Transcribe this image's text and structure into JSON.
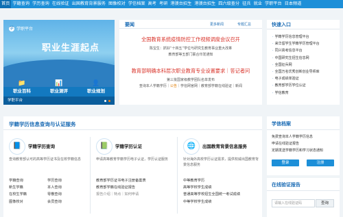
{
  "topnav": [
    "首页",
    "学籍查询",
    "学历查询",
    "在线验证",
    "出国教育背景服务",
    "图像校对",
    "学信档案",
    "高考",
    "考研",
    "港澳台招生",
    "港澳台招生",
    "四六级查分",
    "征兵",
    "就业",
    "学职平台",
    "日本频道"
  ],
  "promo": {
    "logo": "学职平台",
    "headline": "职业生涯起点",
    "icons": [
      {
        "glyph": "📁",
        "label": "职业百科"
      },
      {
        "glyph": "📊",
        "label": "职业测评"
      },
      {
        "glyph": "👤",
        "label": "职业规划"
      }
    ],
    "caption": "学职平台"
  },
  "news": {
    "title": "要闻",
    "more1": "更多新闻",
    "more2": "专题汇总",
    "h1": "全国教育系统疫情防控工作视频调度会议召开",
    "s1": "陈宝生：抓好“十四五”学位与研究生教育事业重大改革",
    "s2": "教育部等五部门联合印发通知",
    "h2": "教育部明确本科层次职业教育专业设置要求｜答记者问",
    "s3": "第三批国家级教学团队名单发布",
    "s4a": "查询本人学籍学历",
    "s4b": "公告",
    "s4c": "学信网官网",
    "s4d": "教育部学籍在线验证",
    "s4e": "新闻"
  },
  "quick": {
    "title": "快速入口",
    "items": [
      "学籍学历信息管理平台",
      "来华留学生学籍学历管理平台",
      "同兴高考信息平台",
      "中国研究生招生信息网",
      "全国征兵网",
      "全国万名优秀创新创业导师库",
      "电子成绩单验证",
      "教育部学历学位认证",
      "学信教育"
    ]
  },
  "main": {
    "title": "学籍学历信息查询与认证服务",
    "cols": [
      {
        "icon": "📘",
        "title": "学籍学历查询",
        "desc": "查询教育部认可的高等学历证书及在校学籍信息",
        "rows": [
          [
            "学籍查询",
            "学历查询"
          ],
          [
            "新生学籍",
            "本人查询"
          ],
          [
            "在校生学籍",
            "零散查询"
          ],
          [
            "图像校对",
            "会员查询"
          ]
        ]
      },
      {
        "icon": "📗",
        "title": "学籍学历认证",
        "desc": "申请高等教育学籍学历电子认证，学历认证服务",
        "rows": [
          [
            "教育部学历证书电子注册备案表"
          ],
          [
            "教育部学籍在线验证报告"
          ],
          [
            "报告介绍｜特点｜如何申请"
          ]
        ]
      },
      {
        "icon": "🌐",
        "title": "出国教育背景信息服务",
        "desc": "针对海外高校学历认证需求，提供权威出国教育背景信息服务",
        "rows": [
          [
            "中等教育学历"
          ],
          [
            "高等学校学生成绩"
          ],
          [
            "普通高等学校招生全国统一考试成绩"
          ],
          [
            "中等学校学生成绩"
          ]
        ]
      }
    ]
  },
  "archive": {
    "title": "学信档案",
    "lines": [
      "免费查询本人学籍学历信息",
      "申请在线验证报告",
      "定期发送学籍学历和学习状态通知"
    ],
    "login": "登录",
    "register": "注册"
  },
  "verify": {
    "title": "在线验证报告",
    "placeholder": "请输入在线验证码",
    "button": "查询"
  }
}
